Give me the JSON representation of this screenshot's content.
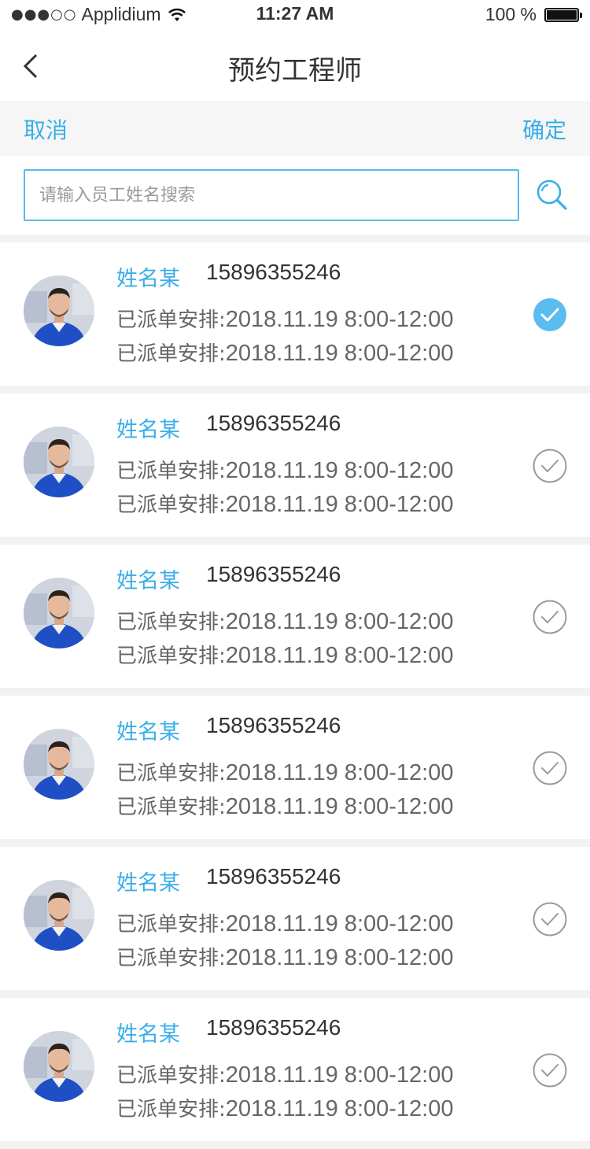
{
  "status_bar": {
    "signal": "●●●○○",
    "carrier": "Applidium",
    "time": "11:27 AM",
    "battery_text": "100 %"
  },
  "nav": {
    "title": "预约工程师",
    "back_icon": "chevron-left-icon"
  },
  "actions": {
    "cancel": "取消",
    "confirm": "确定"
  },
  "search": {
    "placeholder": "请输入员工姓名搜索",
    "value": "",
    "icon": "search-icon"
  },
  "colors": {
    "accent": "#3aaee8",
    "check_selected": "#5bbcf0",
    "check_unselected": "#9a9a9a"
  },
  "engineers": [
    {
      "name": "姓名某",
      "phone": "15896355246",
      "line1_label": "已派单安排:",
      "line1_value": "2018.11.19 8:00-12:00",
      "line2_label": "已派单安排:",
      "line2_value": "2018.11.19 8:00-12:00",
      "selected": true
    },
    {
      "name": "姓名某",
      "phone": "15896355246",
      "line1_label": "已派单安排:",
      "line1_value": "2018.11.19 8:00-12:00",
      "line2_label": "已派单安排:",
      "line2_value": "2018.11.19 8:00-12:00",
      "selected": false
    },
    {
      "name": "姓名某",
      "phone": "15896355246",
      "line1_label": "已派单安排:",
      "line1_value": "2018.11.19 8:00-12:00",
      "line2_label": "已派单安排:",
      "line2_value": "2018.11.19 8:00-12:00",
      "selected": false
    },
    {
      "name": "姓名某",
      "phone": "15896355246",
      "line1_label": "已派单安排:",
      "line1_value": "2018.11.19 8:00-12:00",
      "line2_label": "已派单安排:",
      "line2_value": "2018.11.19 8:00-12:00",
      "selected": false
    },
    {
      "name": "姓名某",
      "phone": "15896355246",
      "line1_label": "已派单安排:",
      "line1_value": "2018.11.19 8:00-12:00",
      "line2_label": "已派单安排:",
      "line2_value": "2018.11.19 8:00-12:00",
      "selected": false
    },
    {
      "name": "姓名某",
      "phone": "15896355246",
      "line1_label": "已派单安排:",
      "line1_value": "2018.11.19 8:00-12:00",
      "line2_label": "已派单安排:",
      "line2_value": "2018.11.19 8:00-12:00",
      "selected": false
    }
  ]
}
